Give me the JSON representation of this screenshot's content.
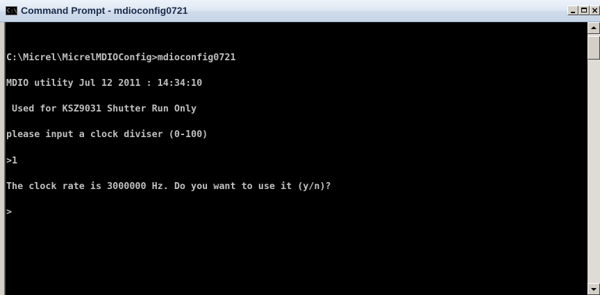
{
  "window": {
    "title": "Command Prompt - mdioconfig0721",
    "icon": "console-app-icon",
    "icon_text": "C:\\",
    "controls": {
      "minimize": "minimize-icon",
      "maximize": "maximize-icon",
      "close": "close-icon"
    }
  },
  "console": {
    "background": "#000000",
    "foreground": "#c0c0c0",
    "lines": [
      "C:\\Micrel\\MicrelMDIOConfig>mdioconfig0721",
      "MDIO utility Jul 12 2011 : 14:34:10",
      " Used for KSZ9031 Shutter Run Only",
      "please input a clock diviser (0-100)",
      ">1",
      "The clock rate is 3000000 Hz. Do you want to use it (y/n)?",
      ">"
    ]
  },
  "scrollbar": {
    "up": "scroll-up-arrow-icon",
    "down": "scroll-down-arrow-icon",
    "position": 0
  }
}
